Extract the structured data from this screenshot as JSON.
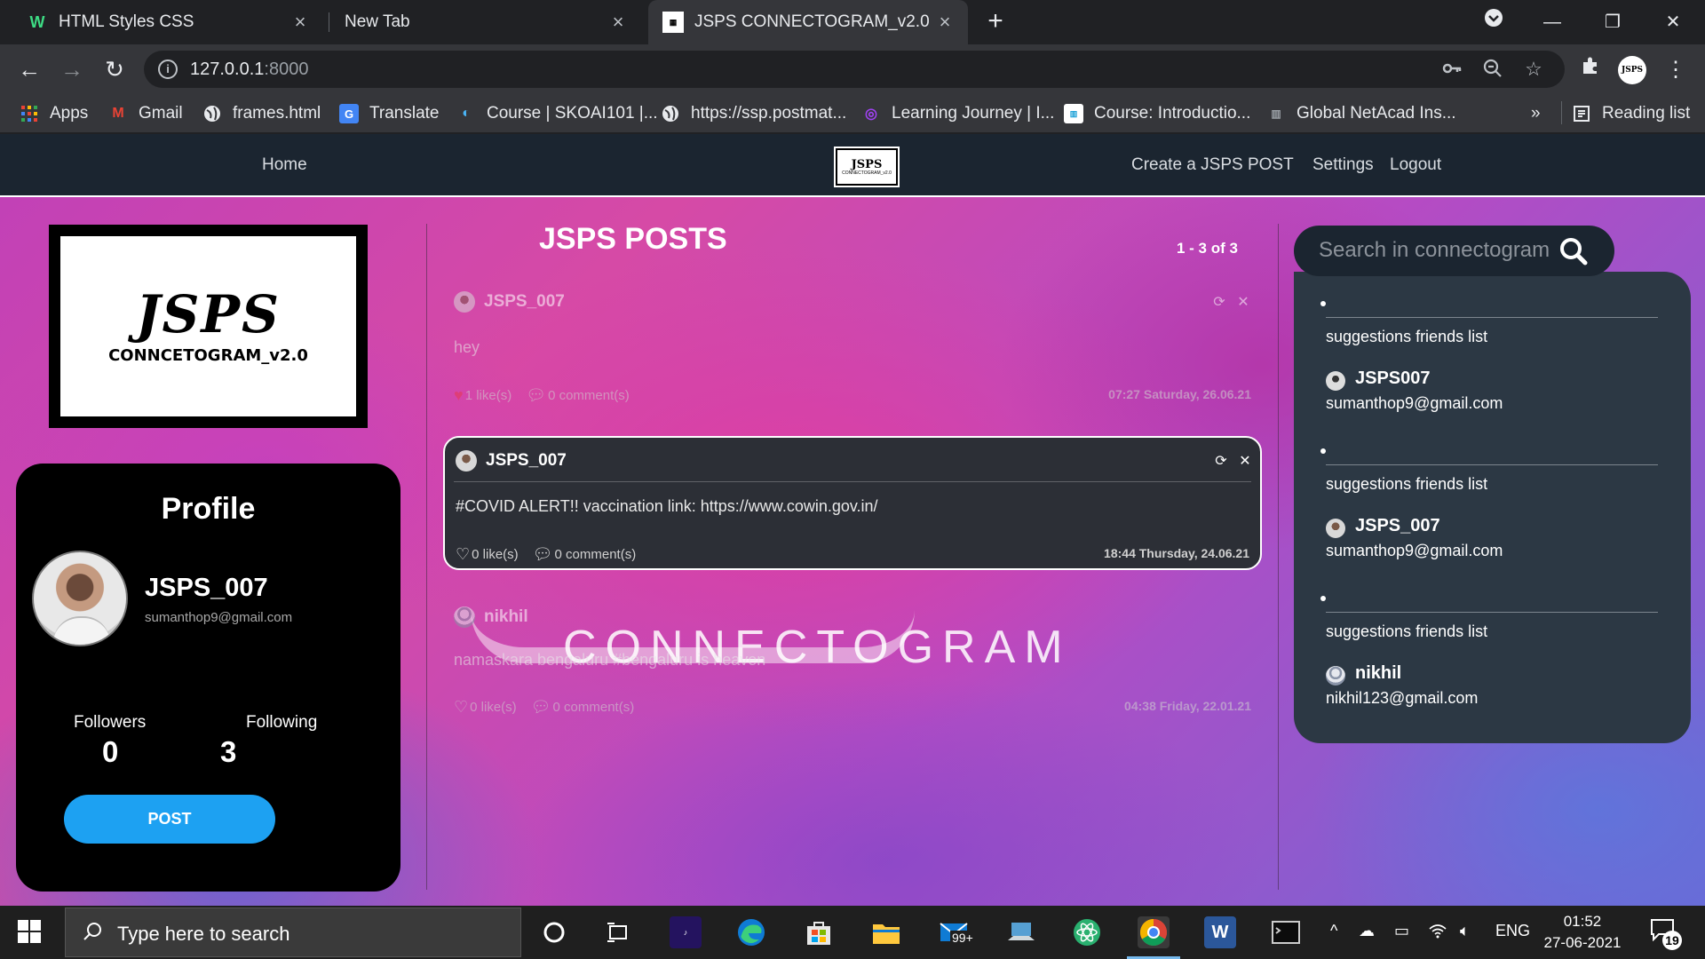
{
  "browser": {
    "tabs": [
      {
        "title": "HTML Styles CSS",
        "favicon": "W"
      },
      {
        "title": "New Tab"
      },
      {
        "title": "JSPS CONNECTOGRAM_v2.0"
      }
    ],
    "url_host": "127.0.0.1",
    "url_port": ":8000",
    "bookmarks": [
      "Apps",
      "Gmail",
      "frames.html",
      "Translate",
      "Course | SKOAI101 |...",
      "https://ssp.postmat...",
      "Learning Journey | I...",
      "Course: Introductio...",
      "Global NetAcad Ins..."
    ],
    "bookmarks_more": "»",
    "reading_list": "Reading list",
    "profile_badge": "JSPS"
  },
  "site": {
    "nav": {
      "home": "Home",
      "create": "Create a JSPS POST",
      "settings": "Settings",
      "logout": "Logout",
      "logo_text": "JSPS",
      "logo_sub": "CONNECTOGRAM_v2.0"
    },
    "brand": {
      "big": "JSPS",
      "small": "CONNCETOGRAM_v2.0"
    },
    "profile": {
      "title": "Profile",
      "username": "JSPS_007",
      "email": "sumanthop9@gmail.com",
      "followers_label": "Followers",
      "followers": "0",
      "following_label": "Following",
      "following": "3",
      "post_button": "POST"
    },
    "feed": {
      "title": "JSPS POSTS",
      "count": "1 - 3 of 3",
      "posts": [
        {
          "user": "JSPS_007",
          "body": "hey",
          "likes": "1 like(s)",
          "comments": "0 comment(s)",
          "time": "07:27 Saturday, 26.06.21"
        },
        {
          "user": "JSPS_007",
          "body": "#COVID ALERT!! vaccination link: https://www.cowin.gov.in/",
          "likes": "0 like(s)",
          "comments": "0 comment(s)",
          "time": "18:44 Thursday, 24.06.21"
        },
        {
          "user": "nikhil",
          "body": "namaskara bengaluru #bengaluru is heaven",
          "likes": "0 like(s)",
          "comments": "0 comment(s)",
          "time": "04:38 Friday, 22.01.21"
        }
      ],
      "watermark": "CONNECTOGRAM"
    },
    "search": {
      "placeholder": "Search in connectogram"
    },
    "suggestions": [
      {
        "heading": "suggestions friends list",
        "name": "JSPS007",
        "email": "sumanthop9@gmail.com"
      },
      {
        "heading": "suggestions friends list",
        "name": "JSPS_007",
        "email": "sumanthop9@gmail.com"
      },
      {
        "heading": "suggestions friends list",
        "name": "nikhil",
        "email": "nikhil123@gmail.com"
      }
    ]
  },
  "taskbar": {
    "search_placeholder": "Type here to search",
    "mail_badge": "99+",
    "lang": "ENG",
    "time": "01:52",
    "date": "27-06-2021",
    "notifications": "19"
  }
}
